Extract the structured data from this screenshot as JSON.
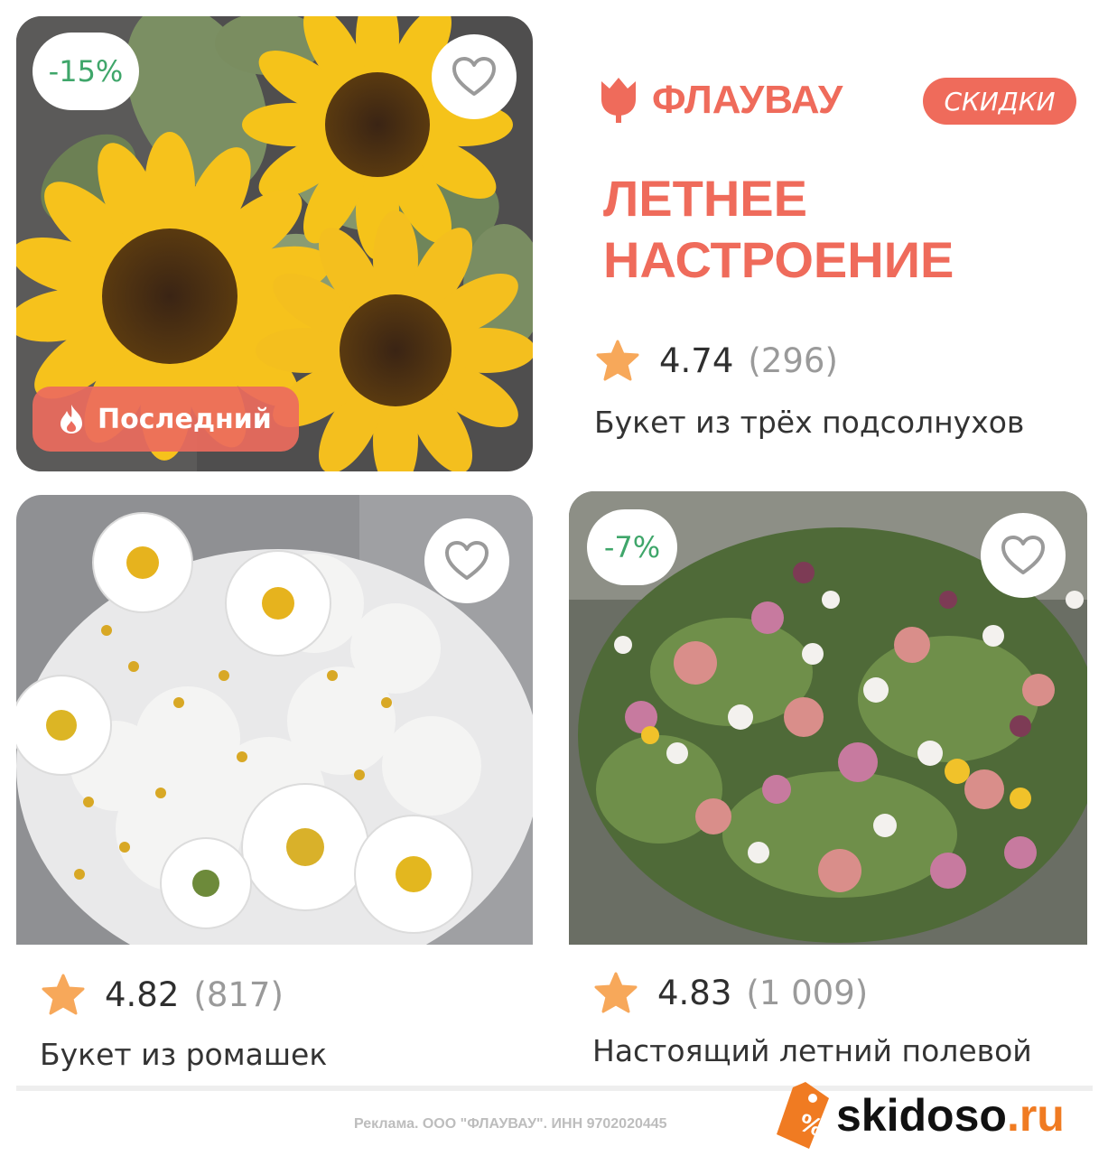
{
  "hero": {
    "discount": "-15%",
    "badge_label": "Последний"
  },
  "brand": {
    "name": "ФЛАУВАУ",
    "sale_label": "СКИДКИ",
    "headline_line1": "ЛЕТНЕЕ",
    "headline_line2": "НАСТРОЕНИЕ",
    "rating": "4.74",
    "reviews": "(296)",
    "product_title": "Букет из трёх подсолнухов"
  },
  "cards": [
    {
      "rating": "4.82",
      "reviews": "(817)",
      "title": "Букет из ромашек",
      "discount": ""
    },
    {
      "rating": "4.83",
      "reviews": "(1 009)",
      "title": "Настоящий летний полевой",
      "discount": "-7%"
    }
  ],
  "footer": {
    "ad_text": "Реклама. ООО \"ФЛАУВАУ\". ИНН 9702020445",
    "watermark_main": "skidoso",
    "watermark_tld": ".ru"
  },
  "colors": {
    "brand_accent": "#ef6b5b",
    "discount_green": "#3fa66a",
    "star": "#f7a85a",
    "watermark_orange": "#f07b22"
  },
  "icons": [
    "heart-icon",
    "star-icon",
    "flame-icon",
    "tulip-logo-icon",
    "percent-tag-icon"
  ]
}
